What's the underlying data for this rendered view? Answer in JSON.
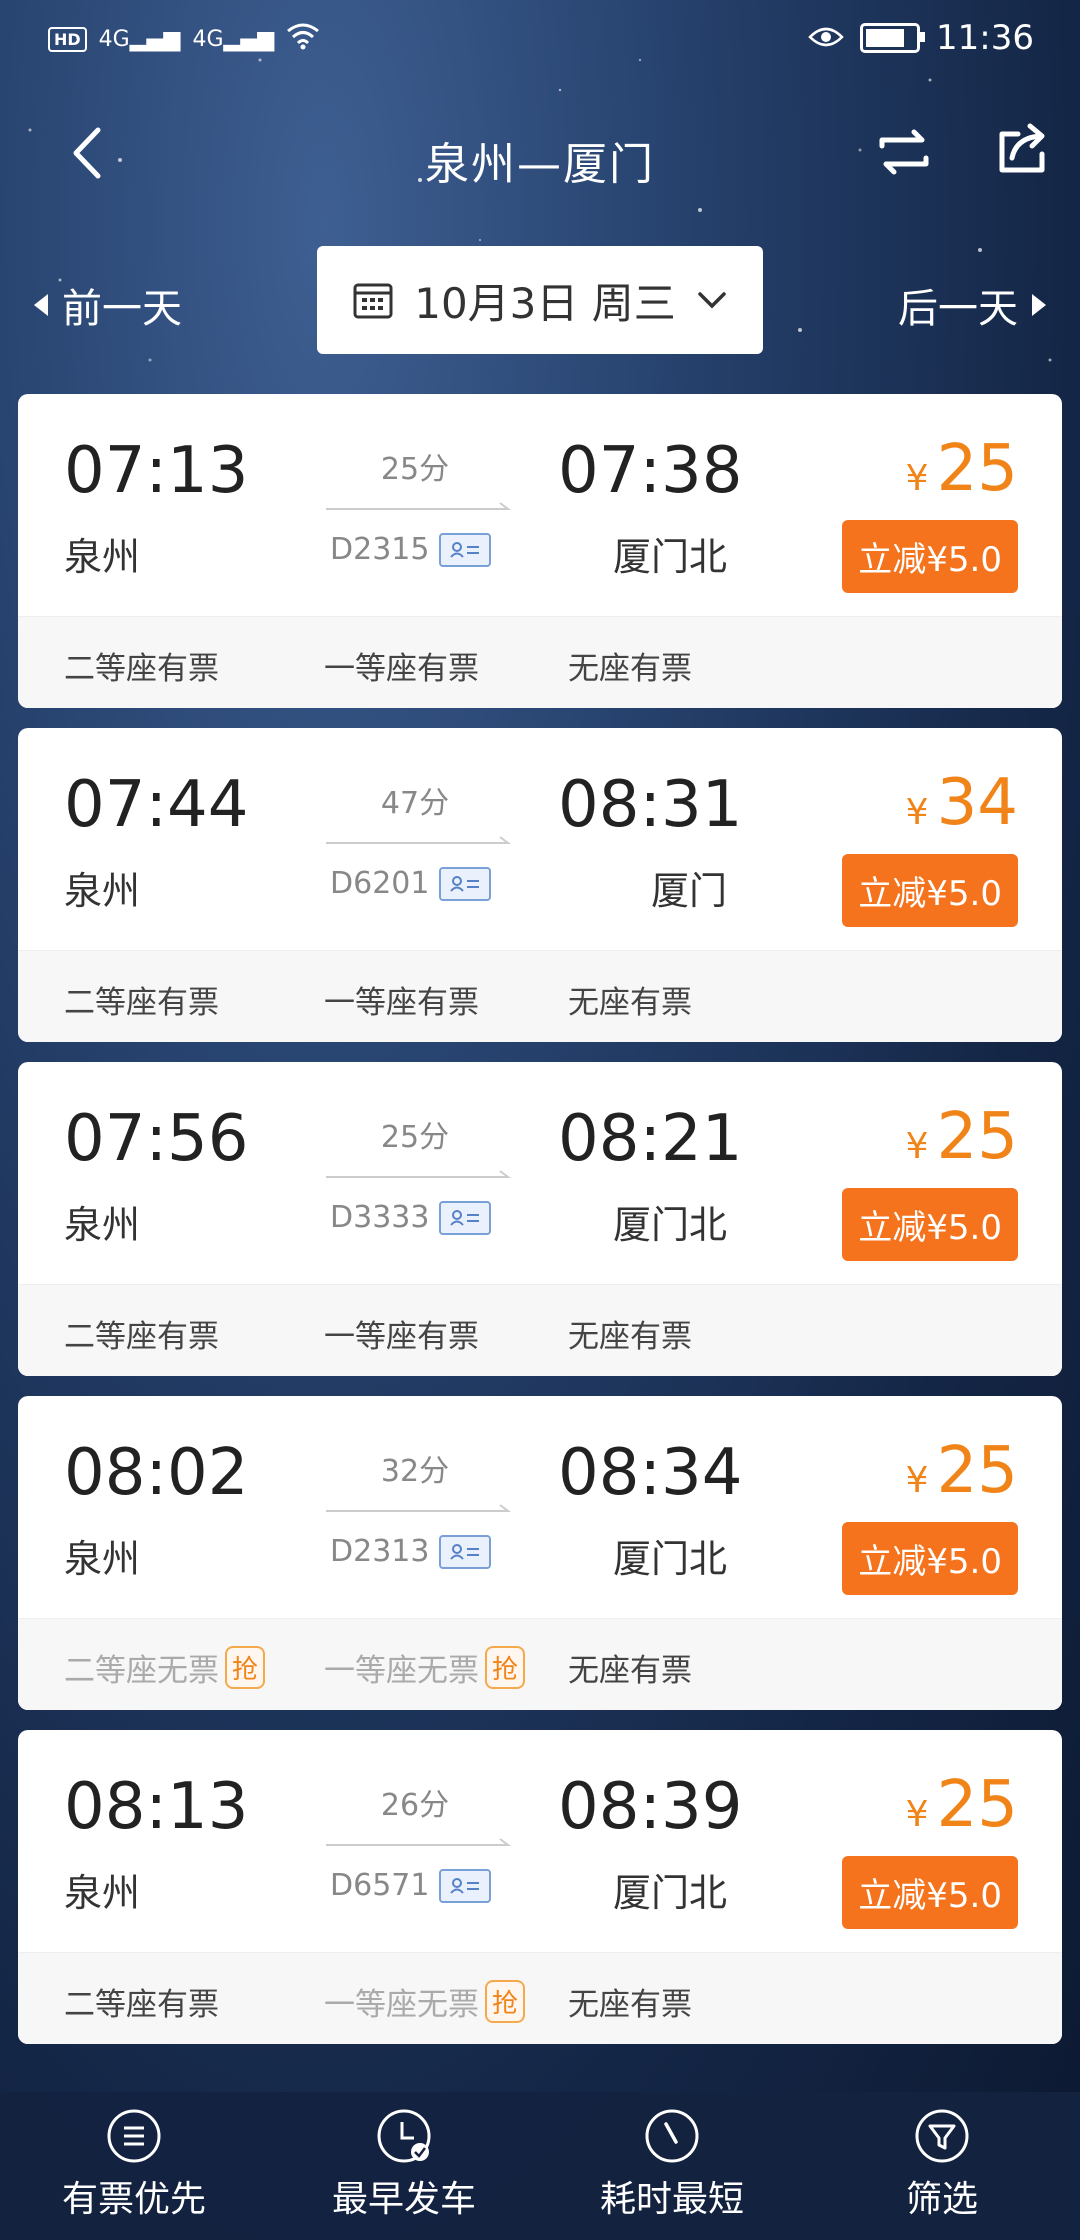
{
  "status": {
    "time": "11:36",
    "hd": "HD",
    "net1": "4G",
    "net2": "4G"
  },
  "header": {
    "title": "泉州—厦门"
  },
  "date_nav": {
    "prev": "前一天",
    "date": "10月3日 周三",
    "next": "后一天"
  },
  "trains": [
    {
      "dep_time": "07:13",
      "dep_station": "泉州",
      "duration": "25分",
      "train_no": "D2315",
      "arr_time": "07:38",
      "arr_station": "厦门北",
      "yen": "¥",
      "price": "25",
      "discount": "立减¥5.0",
      "seats": [
        {
          "text": "二等座有票",
          "grab": ""
        },
        {
          "text": "一等座有票",
          "grab": ""
        },
        {
          "text": "无座有票",
          "grab": ""
        }
      ]
    },
    {
      "dep_time": "07:44",
      "dep_station": "泉州",
      "duration": "47分",
      "train_no": "D6201",
      "arr_time": "08:31",
      "arr_station": "厦门",
      "yen": "¥",
      "price": "34",
      "discount": "立减¥5.0",
      "seats": [
        {
          "text": "二等座有票",
          "grab": ""
        },
        {
          "text": "一等座有票",
          "grab": ""
        },
        {
          "text": "无座有票",
          "grab": ""
        }
      ]
    },
    {
      "dep_time": "07:56",
      "dep_station": "泉州",
      "duration": "25分",
      "train_no": "D3333",
      "arr_time": "08:21",
      "arr_station": "厦门北",
      "yen": "¥",
      "price": "25",
      "discount": "立减¥5.0",
      "seats": [
        {
          "text": "二等座有票",
          "grab": ""
        },
        {
          "text": "一等座有票",
          "grab": ""
        },
        {
          "text": "无座有票",
          "grab": ""
        }
      ]
    },
    {
      "dep_time": "08:02",
      "dep_station": "泉州",
      "duration": "32分",
      "train_no": "D2313",
      "arr_time": "08:34",
      "arr_station": "厦门北",
      "yen": "¥",
      "price": "25",
      "discount": "立减¥5.0",
      "seats": [
        {
          "text": "二等座无票",
          "grab": "抢"
        },
        {
          "text": "一等座无票",
          "grab": "抢"
        },
        {
          "text": "无座有票",
          "grab": ""
        }
      ]
    },
    {
      "dep_time": "08:13",
      "dep_station": "泉州",
      "duration": "26分",
      "train_no": "D6571",
      "arr_time": "08:39",
      "arr_station": "厦门北",
      "yen": "¥",
      "price": "25",
      "discount": "立减¥5.0",
      "seats": [
        {
          "text": "二等座有票",
          "grab": ""
        },
        {
          "text": "一等座无票",
          "grab": "抢"
        },
        {
          "text": "无座有票",
          "grab": ""
        }
      ]
    }
  ],
  "bottom_nav": [
    {
      "label": "有票优先",
      "icon": "list-icon"
    },
    {
      "label": "最早发车",
      "icon": "clock-check-icon"
    },
    {
      "label": "耗时最短",
      "icon": "timer-icon"
    },
    {
      "label": "筛选",
      "icon": "filter-icon"
    }
  ],
  "colors": {
    "accent": "#f08418",
    "discount_bg": "#f5731c",
    "nav_bg": "#142240"
  }
}
